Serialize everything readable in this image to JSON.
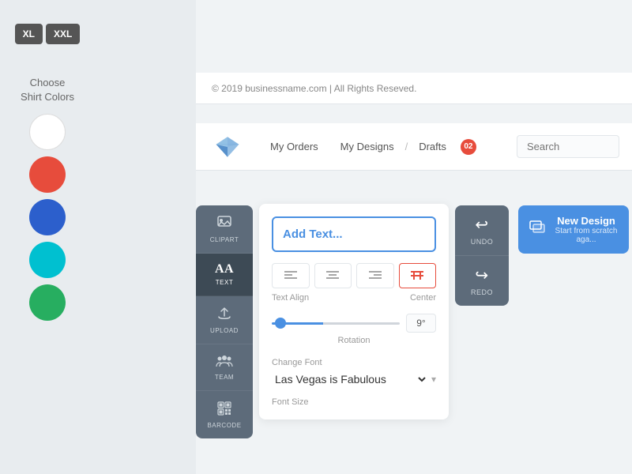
{
  "left_panel": {
    "size_buttons": [
      "XL",
      "XXL"
    ],
    "choose_colors_label": "Choose\nShirt Colors",
    "colors": [
      {
        "name": "white",
        "hex": "#ffffff",
        "border": "#ddd"
      },
      {
        "name": "red",
        "hex": "#e74c3c",
        "border": "none"
      },
      {
        "name": "blue",
        "hex": "#2c5fcc",
        "border": "none"
      },
      {
        "name": "cyan",
        "hex": "#00c0d0",
        "border": "none"
      },
      {
        "name": "green",
        "hex": "#27ae60",
        "border": "none"
      }
    ]
  },
  "footer": {
    "copyright": "© 2019 businessname.com | All Rights Reseved."
  },
  "navbar": {
    "links": [
      {
        "label": "My Orders",
        "separator": false
      },
      {
        "label": "My Designs",
        "separator": false
      },
      {
        "label": "Drafts",
        "separator": true
      }
    ],
    "badge": "02",
    "search_placeholder": "Search"
  },
  "tools": [
    {
      "id": "clipart",
      "label": "CLIPART",
      "icon": "🖼"
    },
    {
      "id": "text",
      "label": "TEXT",
      "icon": "Aa",
      "active": true
    },
    {
      "id": "upload",
      "label": "UPLOAD",
      "icon": "☁"
    },
    {
      "id": "team",
      "label": "TEAM",
      "icon": "👥"
    },
    {
      "id": "barcode",
      "label": "BARCODE",
      "icon": "▦"
    }
  ],
  "editor": {
    "add_text_placeholder": "Add Text...",
    "text_align_label": "Text Align",
    "center_label": "Center",
    "align_options": [
      "left",
      "center",
      "right",
      "justify"
    ],
    "rotation_label": "Rotation",
    "rotation_value": "9°",
    "change_font_label": "Change Font",
    "font_value": "Las Vegas is Fabulous",
    "font_size_label": "Font Size"
  },
  "undo_redo": {
    "undo_label": "UNDO",
    "redo_label": "REDO"
  },
  "new_design": {
    "title": "New Design",
    "subtitle": "Start from scratch aga..."
  }
}
